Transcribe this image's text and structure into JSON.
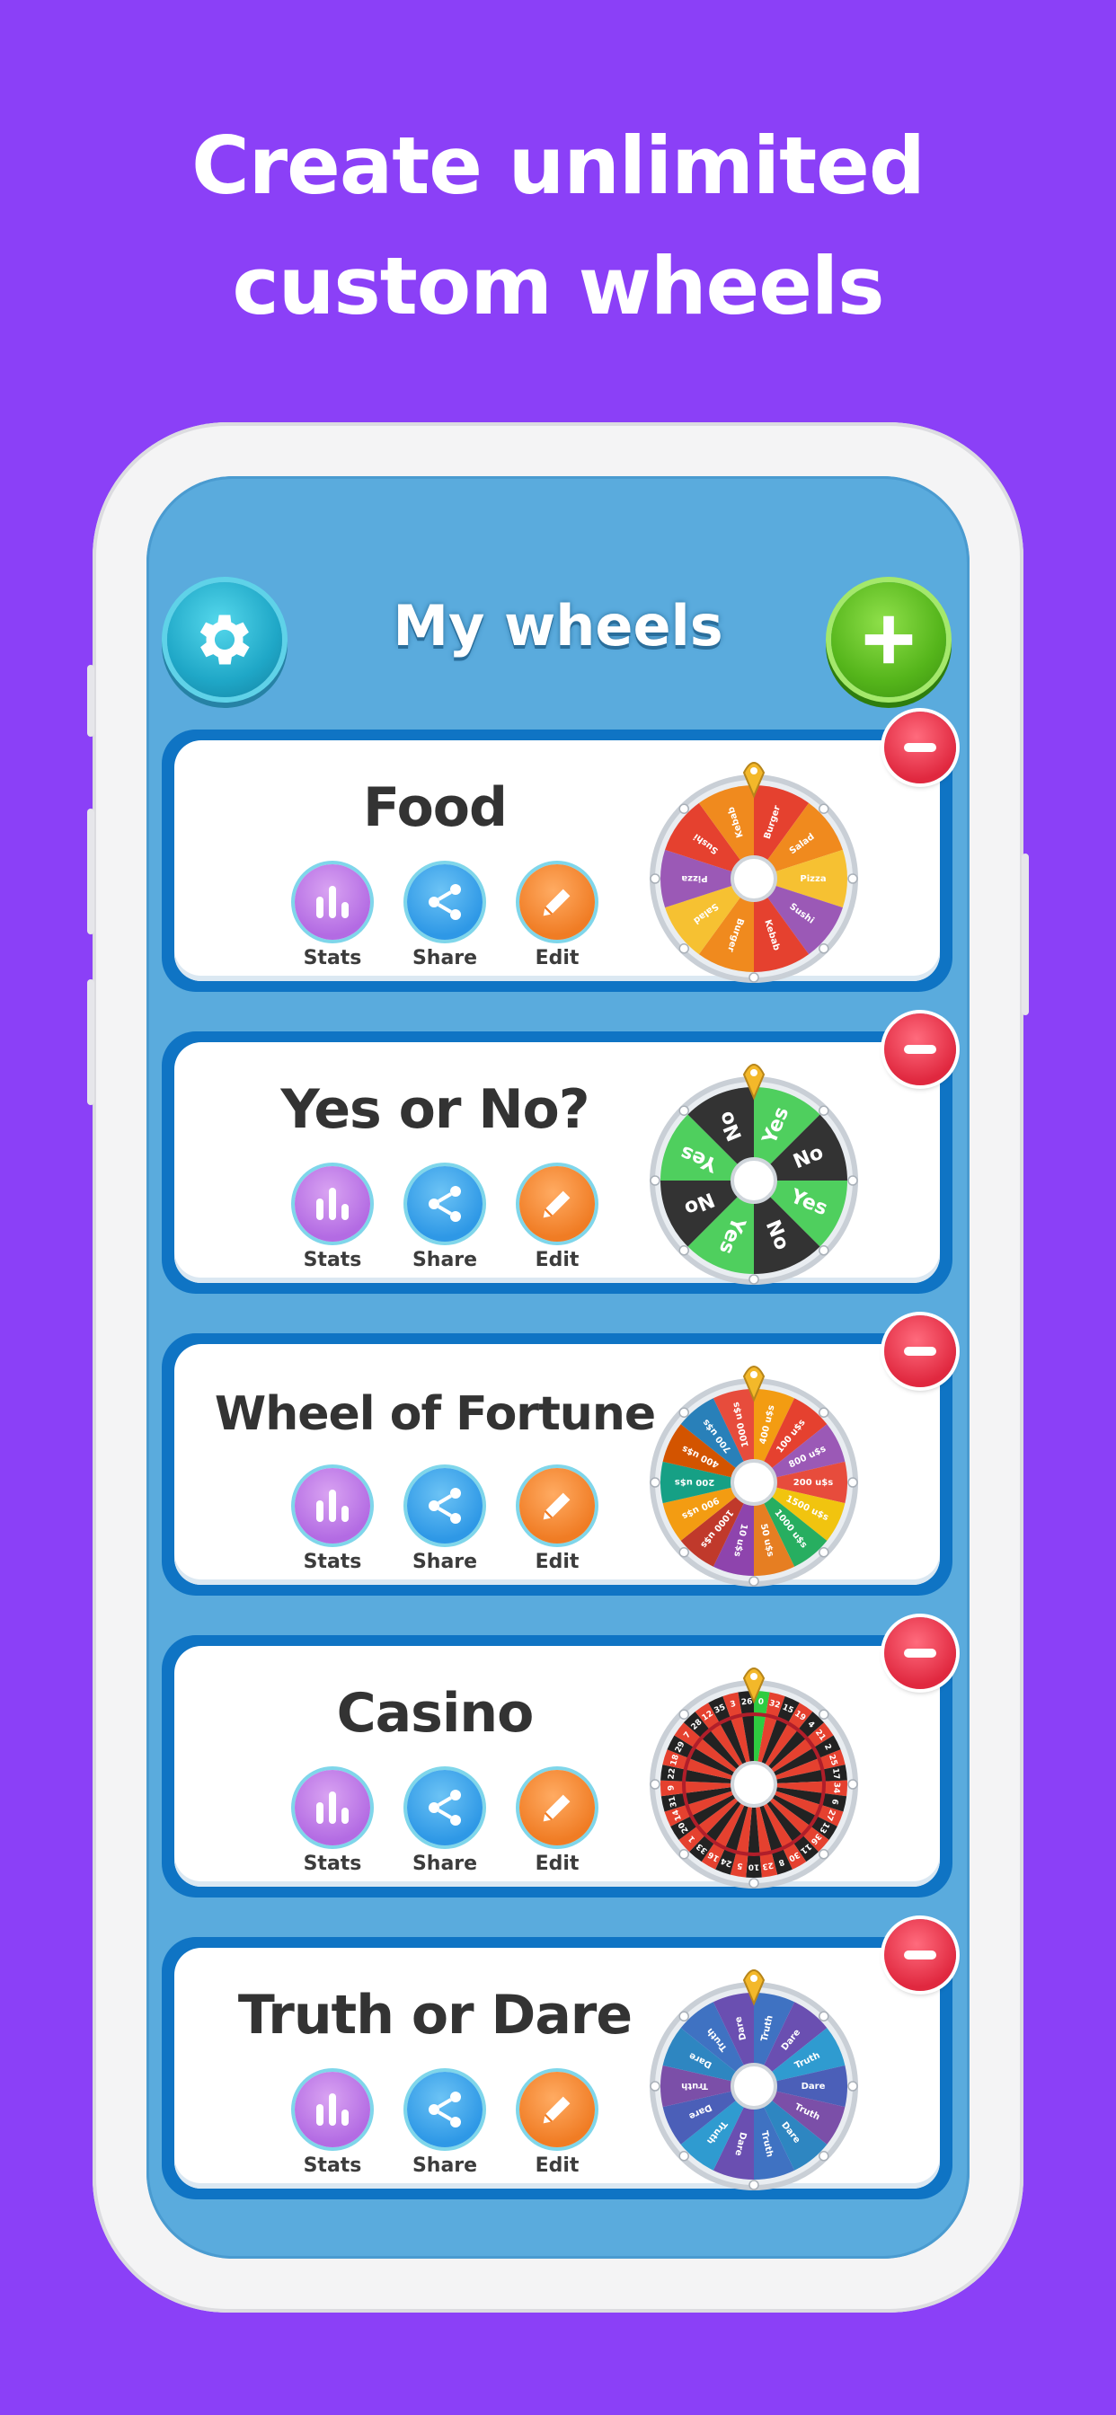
{
  "headline": {
    "line1": "Create unlimited",
    "line2": "custom wheels"
  },
  "header": {
    "title": "My wheels",
    "settings_icon": "gear-icon",
    "add_icon": "plus-icon"
  },
  "actions": {
    "stats": "Stats",
    "share": "Share",
    "edit": "Edit"
  },
  "colors": {
    "background": "#8b40f7",
    "screen": "#5aabdd",
    "card_border": "#0f74c4",
    "stats": "#b36be3",
    "share": "#2e98e6",
    "edit": "#f07c24",
    "delete": "#e0283f",
    "add": "#55b51b",
    "settings": "#1fa7c7"
  },
  "wheels": [
    {
      "name": "Food",
      "segments": [
        "Burger",
        "Salad",
        "Pizza",
        "Sushi",
        "Kebab",
        "Burger",
        "Salad",
        "Pizza",
        "Sushi",
        "Kebab"
      ],
      "colors": [
        "#e5412f",
        "#f08a1e",
        "#f6c132",
        "#9b59b6",
        "#e5412f",
        "#f08a1e",
        "#f6c132",
        "#9b59b6",
        "#e5412f",
        "#f08a1e"
      ]
    },
    {
      "name": "Yes or No?",
      "segments": [
        "Yes",
        "No",
        "Yes",
        "No",
        "Yes",
        "No",
        "Yes",
        "No"
      ],
      "colors": [
        "#4fcf5e",
        "#333333",
        "#4fcf5e",
        "#333333",
        "#4fcf5e",
        "#333333",
        "#4fcf5e",
        "#333333"
      ]
    },
    {
      "name": "Wheel of Fortune",
      "segments": [
        "400 u$s",
        "100 u$s",
        "800 u$s",
        "200 u$s",
        "1500 u$s",
        "1000 u$s",
        "50 u$s",
        "10 u$s",
        "1000 u$s",
        "900 u$s",
        "200 u$s",
        "400 u$s",
        "700 u$s",
        "1000 u$s"
      ],
      "colors": [
        "#f39c12",
        "#e5412f",
        "#9b59b6",
        "#e74c3c",
        "#f1c40f",
        "#27ae60",
        "#e67e22",
        "#8e44ad",
        "#c0392b",
        "#f39c12",
        "#16a085",
        "#d35400",
        "#2980b9",
        "#e74c3c"
      ]
    },
    {
      "name": "Casino",
      "segments": [
        "0",
        "32",
        "15",
        "19",
        "4",
        "21",
        "2",
        "25",
        "17",
        "34",
        "6",
        "27",
        "13",
        "36",
        "11",
        "30",
        "8",
        "23",
        "10",
        "5",
        "24",
        "16",
        "33",
        "1",
        "20",
        "14",
        "31",
        "9",
        "22",
        "18",
        "29",
        "7",
        "28",
        "12",
        "35",
        "3",
        "26"
      ],
      "colors": [
        "#2ecc40",
        "#e5412f",
        "#222222"
      ]
    },
    {
      "name": "Truth or Dare",
      "segments": [
        "Truth",
        "Dare",
        "Truth",
        "Dare",
        "Truth",
        "Dare",
        "Truth",
        "Dare",
        "Truth",
        "Dare",
        "Truth",
        "Dare",
        "Truth",
        "Dare"
      ],
      "colors": [
        "#3f72c2",
        "#6a4fb1",
        "#2f9bd0",
        "#4b5fb8",
        "#7b4fa8",
        "#2e86c1"
      ]
    }
  ]
}
